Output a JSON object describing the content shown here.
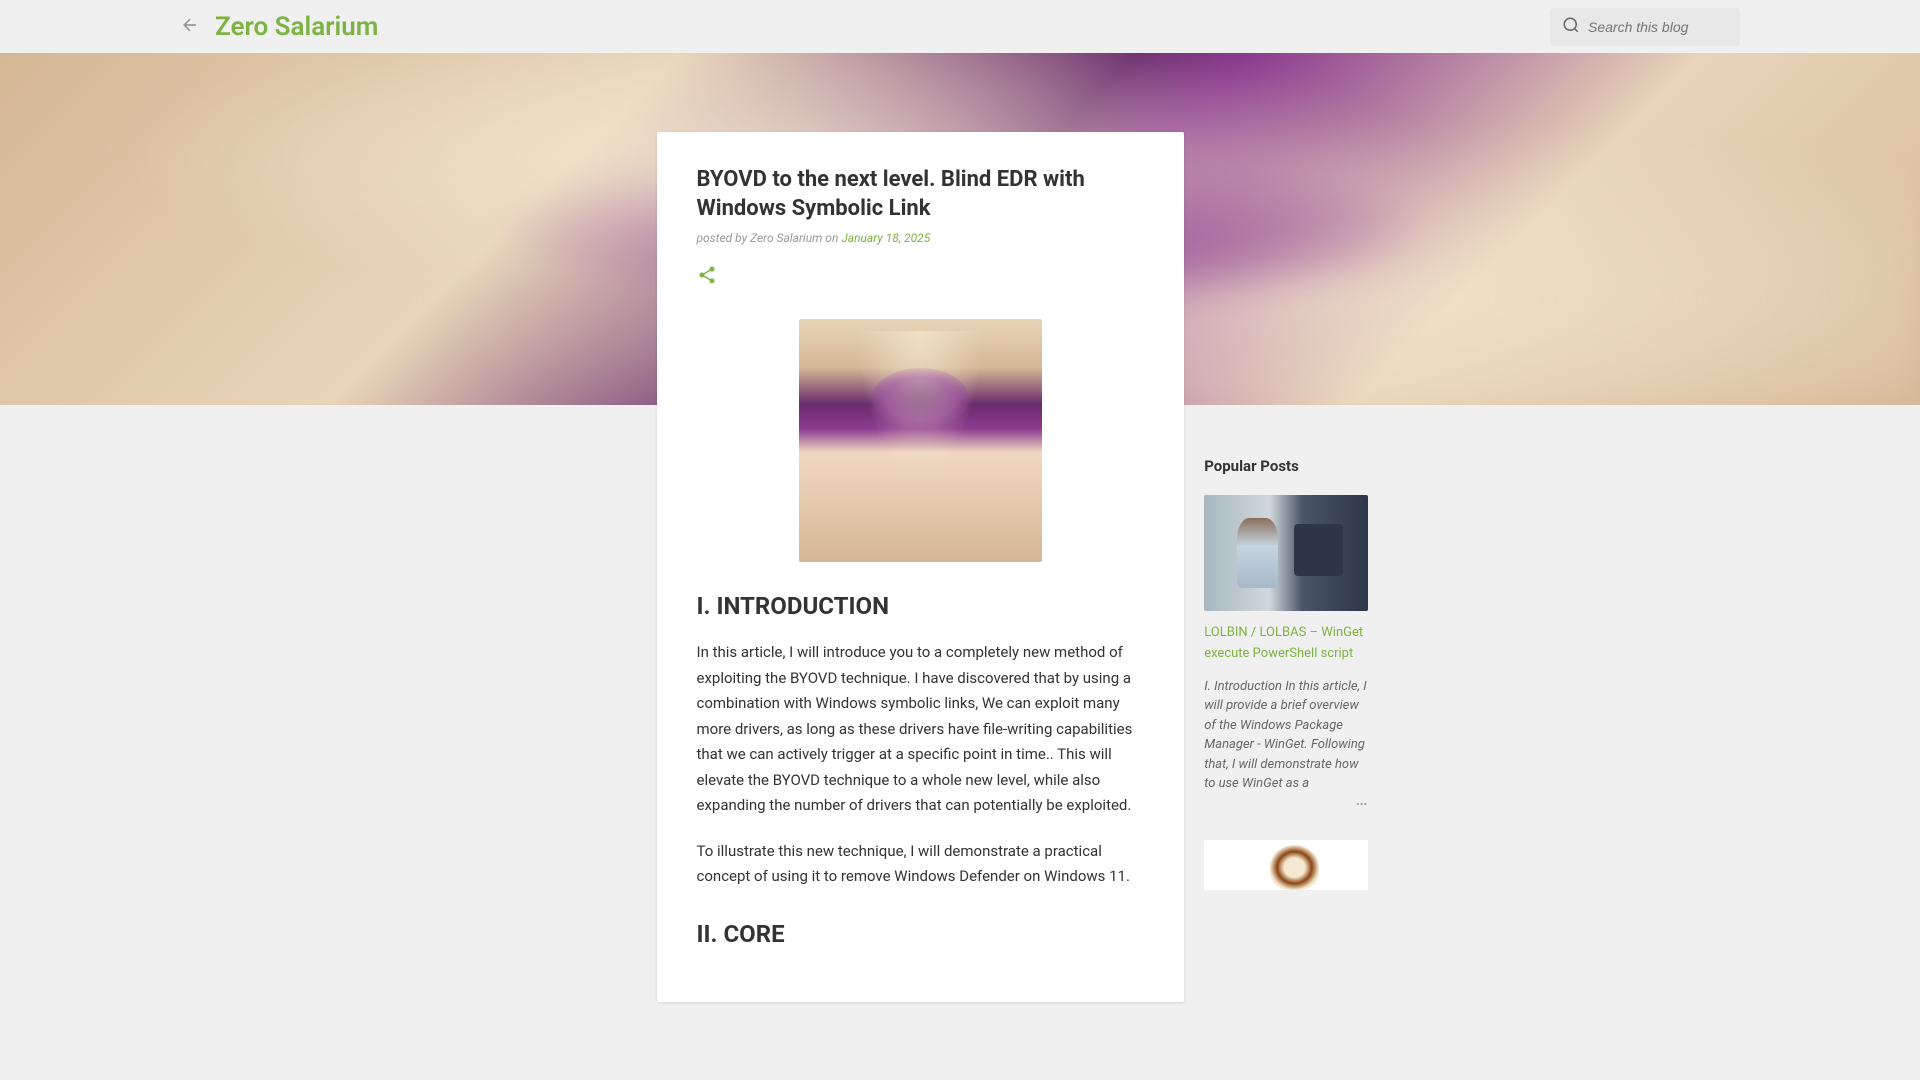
{
  "header": {
    "blog_title": "Zero Salarium",
    "search_placeholder": "Search this blog"
  },
  "article": {
    "title": "BYOVD to the next level. Blind EDR with Windows Symbolic Link",
    "meta_prefix": "posted by ",
    "author": "Zero Salarium",
    "meta_on": " on ",
    "date": "January 18, 2025",
    "section1_heading": " I. INTRODUCTION",
    "paragraph1": "In this article, I will introduce you to a completely new method of exploiting the BYOVD technique. I have discovered that by using a combination with Windows symbolic links, We can exploit many more drivers, as long as these drivers have file-writing capabilities that we can actively trigger at a specific point in time.. This will elevate the BYOVD technique to a whole new level, while also expanding the number of drivers that can potentially be exploited.",
    "paragraph2": "To illustrate this new technique, I will demonstrate a practical concept of using it to remove Windows Defender on Windows 11.",
    "section2_heading": "II. CORE"
  },
  "sidebar": {
    "title": "Popular Posts",
    "post1": {
      "title": "LOLBIN / LOLBAS – WinGet execute PowerShell script",
      "excerpt": "I. Introduction In this article, I will provide a brief overview of the Windows Package Manager - WinGet. Following that, I will demonstrate how to use WinGet as a",
      "ellipsis": "…"
    }
  }
}
